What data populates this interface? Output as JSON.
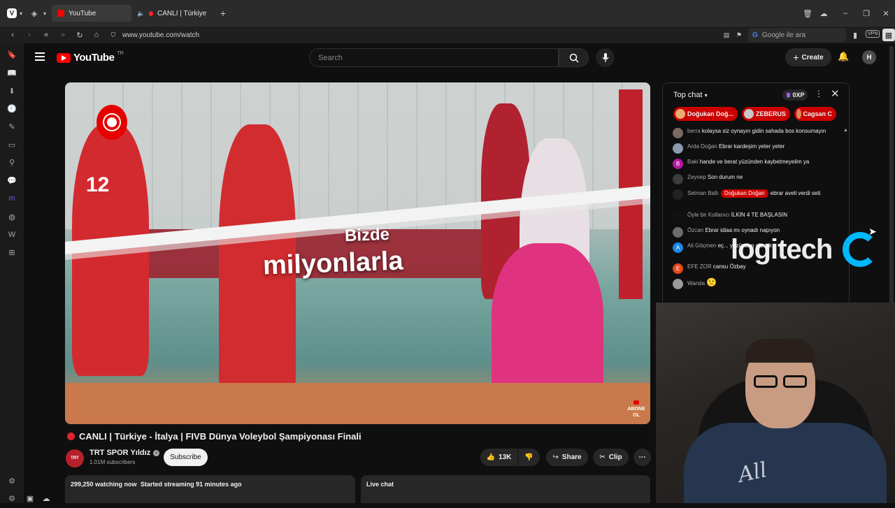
{
  "browser": {
    "tabs": [
      {
        "label": "YouTube"
      },
      {
        "label": "CANLI | Türkiye - İtalya |"
      }
    ],
    "new_tab_icon": "plus-icon",
    "url": "www.youtube.com/watch",
    "search_placeholder": "Google ile ara",
    "vpn_label": "VPN"
  },
  "youtube": {
    "logo_text": "YouTube",
    "country_code": "TR",
    "search_placeholder": "Search",
    "create_label": "Create"
  },
  "video": {
    "overlay_line1": "Bizde",
    "overlay_line2": "milyonlarla",
    "jersey_number": "12",
    "corner_badge": "ABONE OL",
    "title": "CANLI | Türkiye - İtalya | FIVB Dünya Voleybol Şampiyonası Finali"
  },
  "channel": {
    "name": "TRT SPOR Yıldız",
    "subscribers": "1.01M subscribers",
    "subscribe_label": "Subscribe"
  },
  "actions": {
    "likes": "13K",
    "share": "Share",
    "clip": "Clip"
  },
  "description": {
    "watching": "299,250 watching now",
    "started": "Started streaming 91 minutes ago"
  },
  "live_chat_label": "Live chat",
  "chat": {
    "mode": "Top chat",
    "xp": "0XP",
    "tickers": [
      {
        "name": "Doğukan Doğ..."
      },
      {
        "name": "ZEBERUS"
      },
      {
        "name": "Cagsan C"
      }
    ],
    "messages": [
      {
        "name": "berra",
        "text": "kolaysa siz oynayın gidin sahada bos konsumayın",
        "avatar": ""
      },
      {
        "name": "Arda Doğan",
        "text": "Ebrar kardeşim yeter yeter",
        "avatar": ""
      },
      {
        "name": "Baki",
        "text": "hande ve berat yüzünden kaybetmeyelim ya",
        "avatar": "B"
      },
      {
        "name": "Zeynep",
        "text": "Son durum ne",
        "avatar": ""
      },
      {
        "name": "Selman Ballı",
        "mention": "Doğukan Doğan",
        "text": "ebrar aveli verdi seti",
        "avatar": ""
      },
      {
        "name": "Öyle bir Kullanıcı",
        "text": "İLKİN 4 TE BAŞLASIN",
        "avatar": ""
      },
      {
        "name": "Özcan",
        "text": "Ebrar idiaa mı oynadı napıyon",
        "avatar": ""
      },
      {
        "name": "Ali Göçmen",
        "text": "eç... yüzünden olacak",
        "avatar": "A"
      },
      {
        "name": "EFE ZOR",
        "text": "cansu Özbay",
        "avatar": "E"
      },
      {
        "name": "Wanda",
        "text": "🙁",
        "avatar": ""
      }
    ]
  },
  "webcam": {
    "watermark": "logitech",
    "shirt_text": "All"
  },
  "colors": {
    "yt_red": "#ff0000",
    "live_red": "#e0232d",
    "chat_ticker": "#cc0000",
    "logitech_blue": "#00b8fc"
  }
}
